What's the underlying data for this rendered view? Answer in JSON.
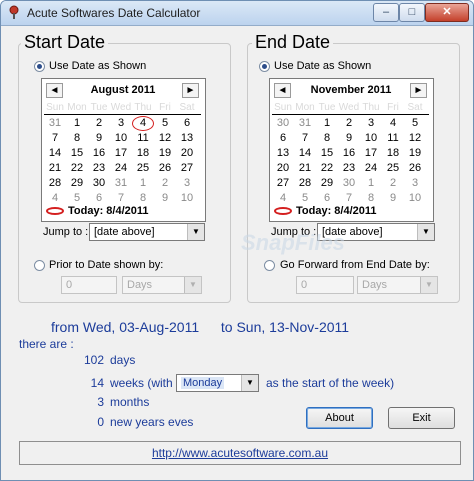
{
  "window": {
    "title": "Acute Softwares Date Calculator",
    "minimize": "–",
    "maximize": "□",
    "close": "✕"
  },
  "start": {
    "heading": "Start Date",
    "use_date_label": "Use Date as Shown",
    "calendar": {
      "month": "August 2011",
      "prev": "◄",
      "next": "►",
      "dow": [
        "Sun",
        "Mon",
        "Tue",
        "Wed",
        "Thu",
        "Fri",
        "Sat"
      ],
      "weeks": [
        [
          "31",
          "1",
          "2",
          "3",
          "4",
          "5",
          "6"
        ],
        [
          "7",
          "8",
          "9",
          "10",
          "11",
          "12",
          "13"
        ],
        [
          "14",
          "15",
          "16",
          "17",
          "18",
          "19",
          "20"
        ],
        [
          "21",
          "22",
          "23",
          "24",
          "25",
          "26",
          "27"
        ],
        [
          "28",
          "29",
          "30",
          "31",
          "1",
          "2",
          "3"
        ],
        [
          "4",
          "5",
          "6",
          "7",
          "8",
          "9",
          "10"
        ]
      ],
      "today": "Today: 8/4/2011"
    },
    "jump_label": "Jump to :",
    "jump_value": "[date above]",
    "prior_label": "Prior to Date shown by:",
    "offset_value": "0",
    "unit_value": "Days"
  },
  "end": {
    "heading": "End Date",
    "use_date_label": "Use Date as Shown",
    "calendar": {
      "month": "November 2011",
      "prev": "◄",
      "next": "►",
      "dow": [
        "Sun",
        "Mon",
        "Tue",
        "Wed",
        "Thu",
        "Fri",
        "Sat"
      ],
      "weeks": [
        [
          "30",
          "31",
          "1",
          "2",
          "3",
          "4",
          "5"
        ],
        [
          "6",
          "7",
          "8",
          "9",
          "10",
          "11",
          "12"
        ],
        [
          "13",
          "14",
          "15",
          "16",
          "17",
          "18",
          "19"
        ],
        [
          "20",
          "21",
          "22",
          "23",
          "24",
          "25",
          "26"
        ],
        [
          "27",
          "28",
          "29",
          "30",
          "1",
          "2",
          "3"
        ],
        [
          "4",
          "5",
          "6",
          "7",
          "8",
          "9",
          "10"
        ]
      ],
      "today": "Today: 8/4/2011"
    },
    "jump_label": "Jump to :",
    "jump_value": "[date above]",
    "forward_label": "Go Forward from End Date by:",
    "offset_value": "0",
    "unit_value": "Days"
  },
  "result": {
    "from_text": "from Wed, 03-Aug-2011",
    "to_text": "to Sun, 13-Nov-2011",
    "there_are": "there are :",
    "days_num": "102",
    "days_label": "days",
    "weeks_num": "14",
    "weeks_label": "weeks (with",
    "week_start": "Monday",
    "weeks_suffix": "as the start of the week)",
    "months_num": "3",
    "months_label": "months",
    "nye_num": "0",
    "nye_label": "new years eves"
  },
  "buttons": {
    "about": "About",
    "exit": "Exit"
  },
  "link": "http://www.acutesoftware.com.au",
  "watermark": "SnapFiles"
}
